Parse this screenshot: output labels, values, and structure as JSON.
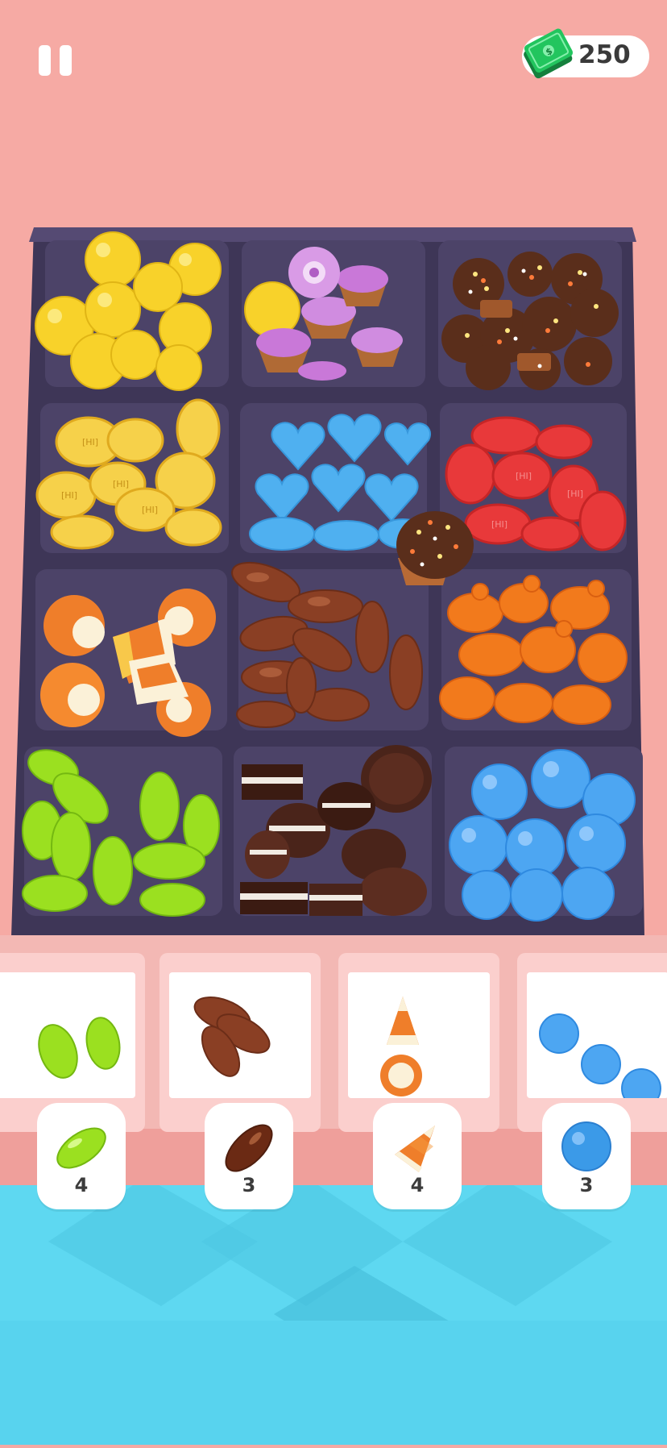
{
  "hud": {
    "pause_icon": "pause-icon",
    "cash_icon": "cash-stack-icon",
    "cash_amount": "250",
    "colors": {
      "background": "#f6aaa4",
      "tray": "#4a4063",
      "cash_green": "#22c55e"
    }
  },
  "tray": {
    "compartments": [
      {
        "candy": "yellow-gumball"
      },
      {
        "candy": "purple-cupcake"
      },
      {
        "candy": "chocolate-muffin"
      },
      {
        "candy": "yellow-candy-disc"
      },
      {
        "candy": "blue-heart-gummy"
      },
      {
        "candy": "red-candy-disc"
      },
      {
        "candy": "candy-corn"
      },
      {
        "candy": "brown-jelly-bean"
      },
      {
        "candy": "orange-gummy-bear"
      },
      {
        "candy": "green-jelly-bean"
      },
      {
        "candy": "chocolate-sandwich-cookie"
      },
      {
        "candy": "blue-gumball"
      }
    ]
  },
  "boxes": [
    {
      "candy": "green-jelly-bean"
    },
    {
      "candy": "brown-jelly-bean"
    },
    {
      "candy": "candy-corn"
    },
    {
      "candy": "blue-gumball"
    }
  ],
  "orders": [
    {
      "candy": "green-jelly-bean",
      "count": "4"
    },
    {
      "candy": "brown-jelly-bean",
      "count": "3"
    },
    {
      "candy": "candy-corn",
      "count": "4"
    },
    {
      "candy": "blue-gumball",
      "count": "3"
    }
  ]
}
